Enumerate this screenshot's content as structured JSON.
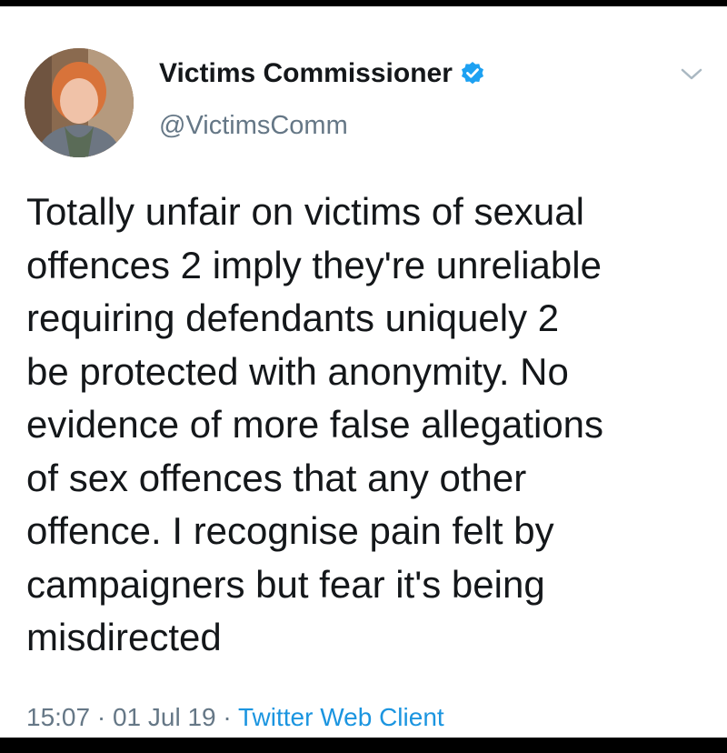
{
  "tweet": {
    "display_name": "Victims Commissioner",
    "handle": "@VictimsComm",
    "verified_icon": "verified-badge-icon",
    "menu_icon": "chevron-down-icon",
    "text": "Totally unfair on victims of sexual\noffences 2 imply they're unreliable\nrequiring defendants uniquely 2\nbe protected with anonymity. No\nevidence of more false allegations\nof sex offences that any other\noffence. I recognise pain felt by\ncampaigners but fear it's being\nmisdirected",
    "time": "15:07",
    "separator": "·",
    "date": "01 Jul 19",
    "source": "Twitter Web Client"
  },
  "colors": {
    "text": "#14171a",
    "secondary": "#657786",
    "link": "#1b95e0",
    "verified": "#1da1f2"
  }
}
